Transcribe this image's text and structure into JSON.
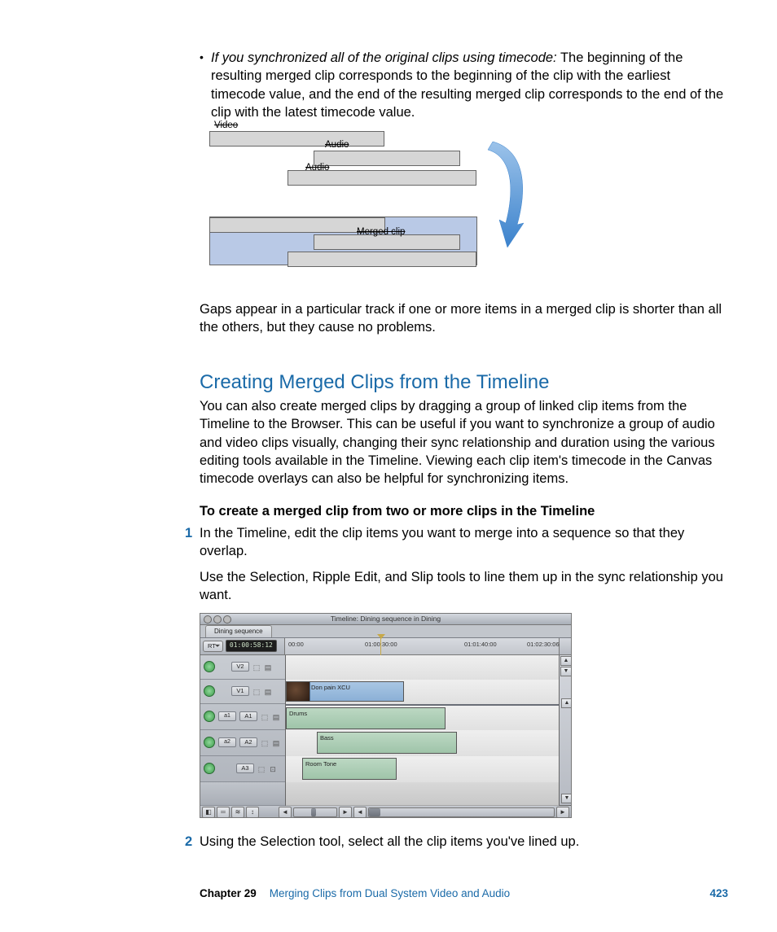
{
  "bullet": {
    "lead": "If you synchronized all of the original clips using timecode:",
    "rest": "  The beginning of the resulting merged clip corresponds to the beginning of the clip with the earliest timecode value, and the end of the resulting merged clip corresponds to the end of the clip with the latest timecode value."
  },
  "diagram": {
    "video": "Video",
    "audio1": "Audio",
    "audio2": "Audio",
    "merged": "Merged clip"
  },
  "gap_paragraph": "Gaps appear in a particular track if one or more items in a merged clip is shorter than all the others, but they cause no problems.",
  "section_title": "Creating Merged Clips from the Timeline",
  "section_p": "You can also create merged clips by dragging a group of linked clip items from the Timeline to the Browser. This can be useful if you want to synchronize a group of audio and video clips visually, changing their sync relationship and duration using the various editing tools available in the Timeline. Viewing each clip item's timecode in the Canvas timecode overlays can also be helpful for synchronizing items.",
  "steps_heading": "To create a merged clip from two or more clips in the Timeline",
  "steps": {
    "n1": "1",
    "t1": "In the Timeline, edit the clip items you want to merge into a sequence so that they overlap.",
    "t1b": "Use the Selection, Ripple Edit, and Slip tools to line them up in the sync relationship you want.",
    "n2": "2",
    "t2": "Using the Selection tool, select all the clip items you've lined up."
  },
  "timeline": {
    "window_title": "Timeline: Dining sequence in Dining",
    "tab": "Dining sequence",
    "rt": "RT",
    "timecode": "01:00:58:12",
    "ruler": [
      "00:00",
      "01:00:30:00",
      "01:01:40:00",
      "01:02:30:06"
    ],
    "tracks": {
      "v2": "V2",
      "v1": "V1",
      "a1p": "a1",
      "a1": "A1",
      "a2p": "a2",
      "a2": "A2",
      "a3": "A3"
    },
    "clips": {
      "video": "Don pain XCU",
      "drums": "Drums",
      "bass": "Bass",
      "room": "Room Tone"
    }
  },
  "footer": {
    "chapter": "Chapter 29",
    "title": "Merging Clips from Dual System Video and Audio",
    "page": "423"
  }
}
